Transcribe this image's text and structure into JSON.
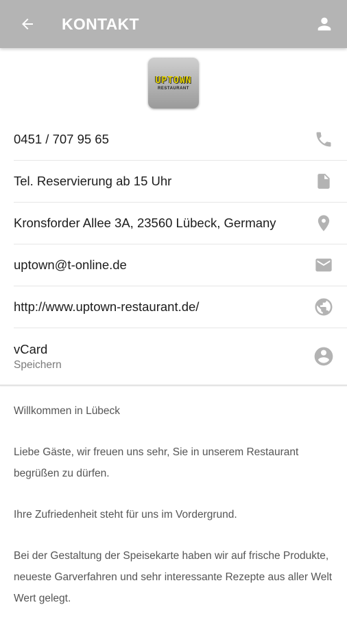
{
  "header": {
    "title": "KONTAKT",
    "back_icon": "arrow-left-icon",
    "account_icon": "person-icon",
    "background": "#b4b4b4"
  },
  "logo": {
    "brand": "UPTOWN",
    "sub": "RESTAURANT"
  },
  "contact_items": [
    {
      "label": "0451 / 707 95 65",
      "icon": "phone-icon"
    },
    {
      "label": "Tel. Reservierung ab 15 Uhr",
      "icon": "document-icon"
    },
    {
      "label": "Kronsforder Allee 3A, 23560 Lübeck, Germany",
      "icon": "location-pin-icon"
    },
    {
      "label": "uptown@t-online.de",
      "icon": "mail-icon"
    },
    {
      "label": "http://www.uptown-restaurant.de/",
      "icon": "globe-icon"
    }
  ],
  "vcard": {
    "label": "vCard",
    "sublabel": "Speichern",
    "icon": "account-circle-icon"
  },
  "description": [
    "Willkommen in Lübeck",
    "Liebe Gäste, wir freuen uns sehr, Sie in unserem Restaurant begrüßen zu dürfen.",
    "Ihre Zufriedenheit steht für uns im Vordergrund.",
    "Bei der Gestaltung der Speisekarte haben wir auf frische Produkte, neueste Garverfahren und sehr interessante Rezepte aus aller Welt Wert gelegt."
  ],
  "colors": {
    "icon_gray": "#b3b3b3",
    "text_dark": "#1c1c1c",
    "text_body": "#555555"
  }
}
